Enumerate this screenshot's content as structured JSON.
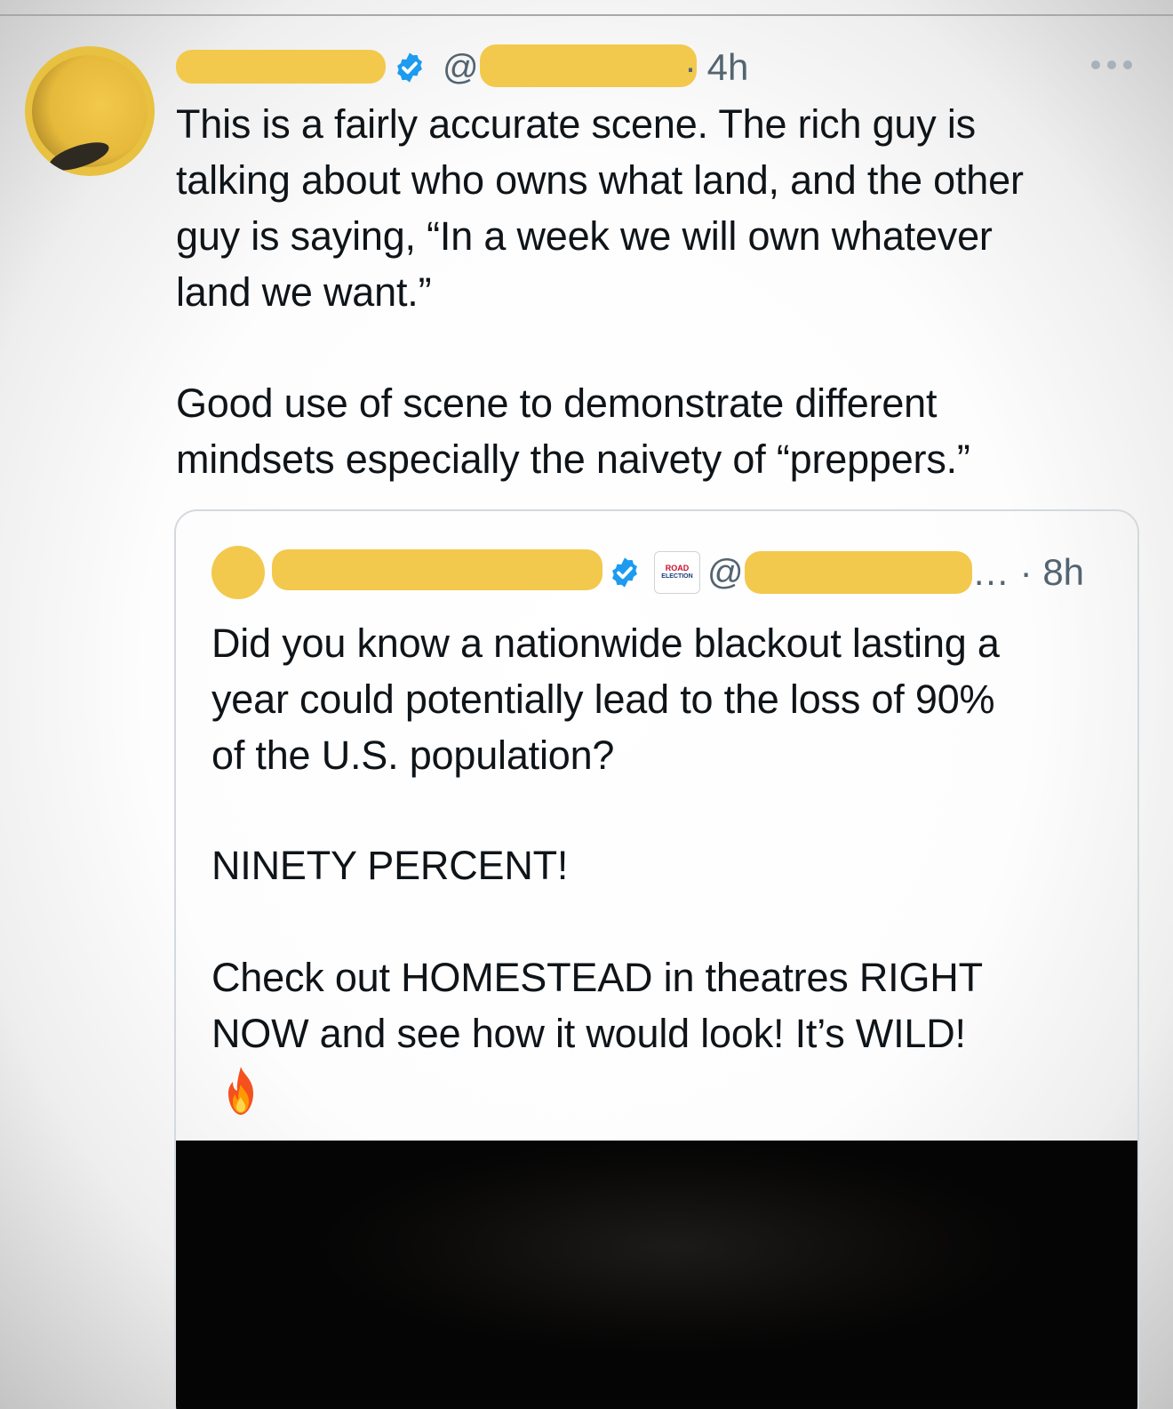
{
  "tweet": {
    "handle_prefix": "@",
    "time": "· 4h",
    "paragraphs": [
      [
        "This is a fairly accurate scene. The rich guy is",
        "talking about who owns what land, and the other",
        "guy is saying, “In a week we will own whatever",
        "land we want.”"
      ],
      [
        "Good use of scene to demonstrate different",
        "mindsets especially the naivety of “preppers.”"
      ]
    ]
  },
  "quoted_tweet": {
    "badge_line1": "ROAD",
    "badge_line2": "ELECTION",
    "handle_prefix": "@",
    "time": "… · 8h",
    "paragraphs": [
      [
        "Did you know a nationwide blackout lasting a",
        "year could potentially lead to the loss of 90%",
        "of the U.S. population?"
      ],
      [
        "NINETY PERCENT!"
      ],
      [
        "Check out HOMESTEAD in theatres RIGHT",
        "NOW and see how it would look! It’s WILD!"
      ]
    ]
  },
  "icons": {
    "verified": "verified-badge-icon",
    "more": "more-options-icon",
    "fire": "fire-emoji-icon"
  },
  "colors": {
    "redaction": "#f2c94c",
    "verified_blue": "#1d9bf0",
    "secondary_text": "#536471",
    "card_border": "#d4d9dd"
  }
}
